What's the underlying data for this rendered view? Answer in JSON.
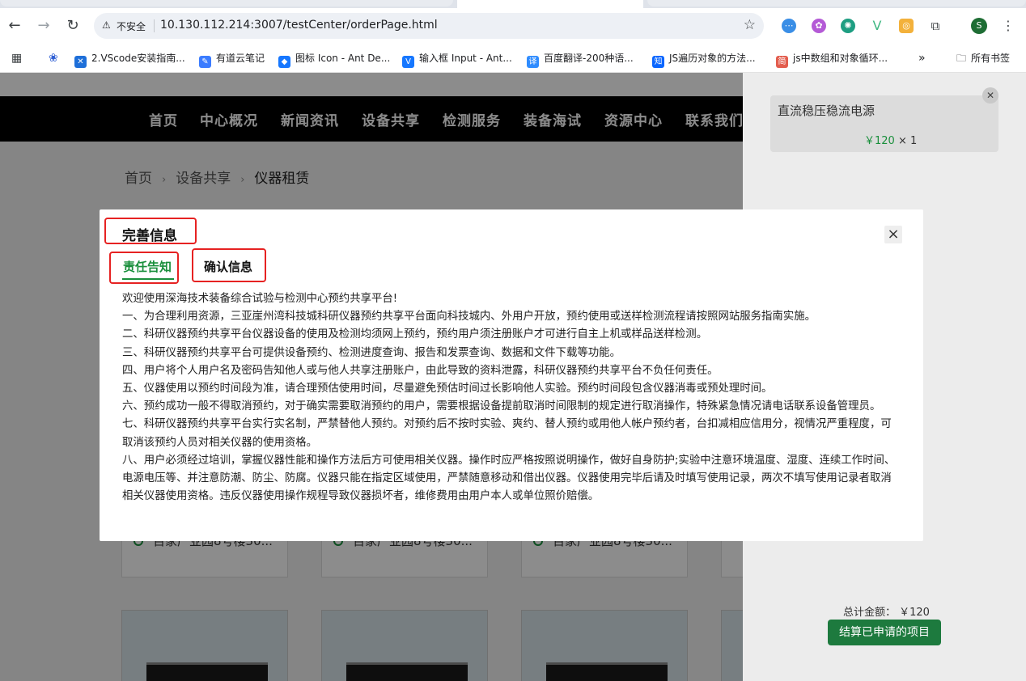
{
  "browser": {
    "url_security": "不安全",
    "url": "10.130.112.214:3007/testCenter/orderPage.html",
    "profile_initial": "S",
    "bookmarks": [
      {
        "label": "2.VScode安装指南...",
        "icon": "vscode-icon",
        "color": "#1e6fd9"
      },
      {
        "label": "有道云笔记",
        "icon": "youdao-note-icon",
        "color": "#3b7cff"
      },
      {
        "label": "图标 Icon - Ant De...",
        "icon": "ant-design-icon",
        "color": "#1677ff"
      },
      {
        "label": "输入框 Input - Ant...",
        "icon": "ant-design-icon",
        "color": "#1677ff"
      },
      {
        "label": "百度翻译-200种语...",
        "icon": "baidu-translate-icon",
        "color": "#2f8cff"
      },
      {
        "label": "JS遍历对象的方法...",
        "icon": "zhihu-icon",
        "color": "#0a66ff"
      },
      {
        "label": "js中数组和对象循环...",
        "icon": "jianshu-icon",
        "color": "#e35d4e"
      }
    ],
    "more_bookmarks": "»",
    "all_bookmarks": "所有书签"
  },
  "site": {
    "nav": [
      "首页",
      "中心概况",
      "新闻资讯",
      "设备共享",
      "检测服务",
      "装备海试",
      "资源中心",
      "联系我们"
    ],
    "breadcrumb": [
      "首页",
      "设备共享",
      "仪器租赁"
    ],
    "card_address": "百家产业园8号楼30..."
  },
  "cart": {
    "item_name": "直流稳压稳流电源",
    "item_price": "￥120",
    "item_qty": "× 1",
    "total_label": "总计金额： ￥120",
    "checkout_label": "结算已申请的项目",
    "colors": {
      "accent": "#1d7a3e"
    }
  },
  "modal": {
    "title": "完善信息",
    "tabs": [
      "责任告知",
      "确认信息"
    ],
    "close": "×",
    "notice": [
      "欢迎使用深海技术装备综合试验与检测中心预约共享平台!",
      "一、为合理利用资源，三亚崖州湾科技城科研仪器预约共享平台面向科技城内、外用户开放，预约使用或送样检测流程请按照网站服务指南实施。",
      "二、科研仪器预约共享平台仪器设备的使用及检测均须网上预约，预约用户须注册账户才可进行自主上机或样品送样检测。",
      "三、科研仪器预约共享平台可提供设备预约、检测进度查询、报告和发票查询、数据和文件下载等功能。",
      "四、用户将个人用户名及密码告知他人或与他人共享注册账户，由此导致的资料泄露，科研仪器预约共享平台不负任何责任。",
      "五、仪器使用以预约时间段为准，请合理预估使用时间，尽量避免预估时间过长影响他人实验。预约时间段包含仪器消毒或预处理时间。",
      "六、预约成功一般不得取消预约，对于确实需要取消预约的用户，需要根据设备提前取消时间限制的规定进行取消操作，特殊紧急情况请电话联系设备管理员。",
      "七、科研仪器预约共享平台实行实名制，严禁替他人预约。对预约后不按时实验、爽约、替人预约或用他人帐户预约者，台扣减相应信用分，视情况严重程度，可取消该预约人员对相关仪器的使用资格。",
      "八、用户必须经过培训，掌握仪器性能和操作方法后方可使用相关仪器。操作时应严格按照说明操作，做好自身防护;实验中注意环境温度、湿度、连续工作时间、电源电压等、并注意防潮、防尘、防腐。仪器只能在指定区域使用，严禁随意移动和借出仪器。仪器使用完毕后请及时填写使用记录，两次不填写使用记录者取消相关仪器使用资格。违反仪器使用操作规程导致仪器损坏者，维修费用由用户本人或单位照价赔偿。"
    ],
    "colors": {
      "active_tab": "#1a8f3c",
      "highlight_box": "#e62222"
    }
  }
}
